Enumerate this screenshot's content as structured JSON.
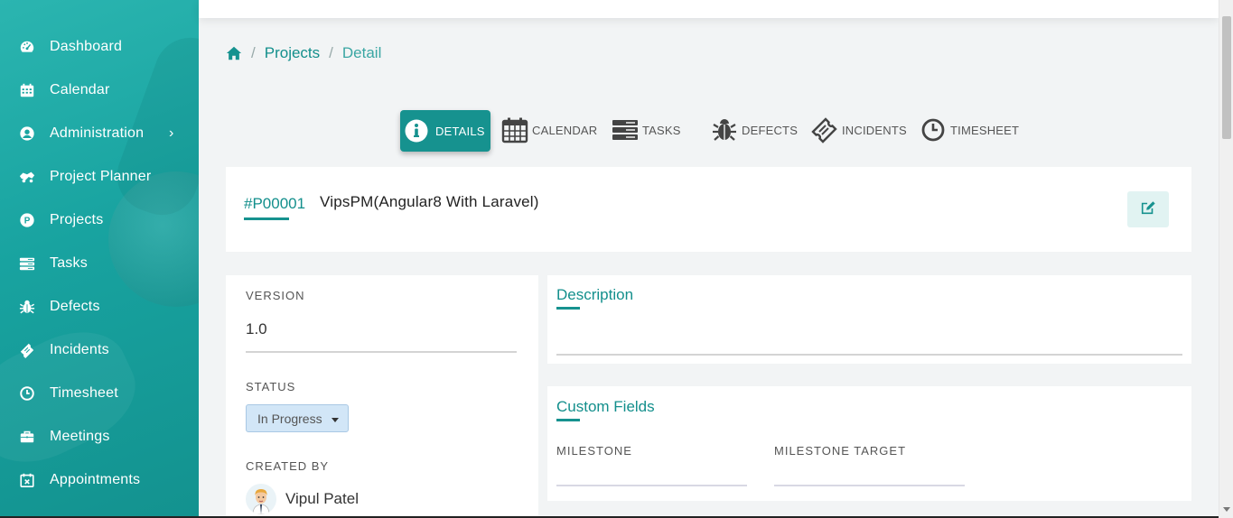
{
  "sidebar": {
    "items": [
      {
        "label": "Dashboard",
        "icon": "dashboard-icon"
      },
      {
        "label": "Calendar",
        "icon": "calendar-icon"
      },
      {
        "label": "Administration",
        "icon": "user-circle-icon",
        "has_submenu": true
      },
      {
        "label": "Project Planner",
        "icon": "project-planner-icon"
      },
      {
        "label": "Projects",
        "icon": "projects-p-icon"
      },
      {
        "label": "Tasks",
        "icon": "tasks-icon"
      },
      {
        "label": "Defects",
        "icon": "bug-icon"
      },
      {
        "label": "Incidents",
        "icon": "ticket-icon"
      },
      {
        "label": "Timesheet",
        "icon": "clock-icon"
      },
      {
        "label": "Meetings",
        "icon": "briefcase-icon"
      },
      {
        "label": "Appointments",
        "icon": "calendar-x-icon"
      }
    ],
    "submenu_chevron": "›"
  },
  "breadcrumb": {
    "home_icon": "home-icon",
    "separator": "/",
    "items": [
      "Projects",
      "Detail"
    ]
  },
  "tabs": [
    {
      "label": "DETAILS",
      "icon": "info-icon",
      "active": true
    },
    {
      "label": "CALENDAR",
      "icon": "calendar-icon",
      "active": false
    },
    {
      "label": "TASKS",
      "icon": "tasks-icon",
      "active": false
    },
    {
      "label": "DEFECTS",
      "icon": "bug-icon",
      "active": false
    },
    {
      "label": "INCIDENTS",
      "icon": "ticket-icon",
      "active": false
    },
    {
      "label": "TIMESHEET",
      "icon": "clock-icon",
      "active": false
    }
  ],
  "project": {
    "code": "#P00001",
    "name": "VipsPM(Angular8 With Laravel)",
    "edit_icon": "edit-icon"
  },
  "info": {
    "version_label": "VERSION",
    "version_value": "1.0",
    "status_label": "STATUS",
    "status_value": "In Progress",
    "created_by_label": "CREATED BY",
    "created_by_name": "Vipul Patel"
  },
  "description": {
    "title": "Description",
    "value": ""
  },
  "custom_fields": {
    "title": "Custom Fields",
    "fields": [
      {
        "label": "MILESTONE",
        "value": ""
      },
      {
        "label": "MILESTONE TARGET",
        "value": ""
      }
    ]
  },
  "colors": {
    "accent": "#16928f",
    "sidebar_start": "#2bb5b0",
    "sidebar_end": "#13928f",
    "status_bg": "#d2e6f7"
  }
}
